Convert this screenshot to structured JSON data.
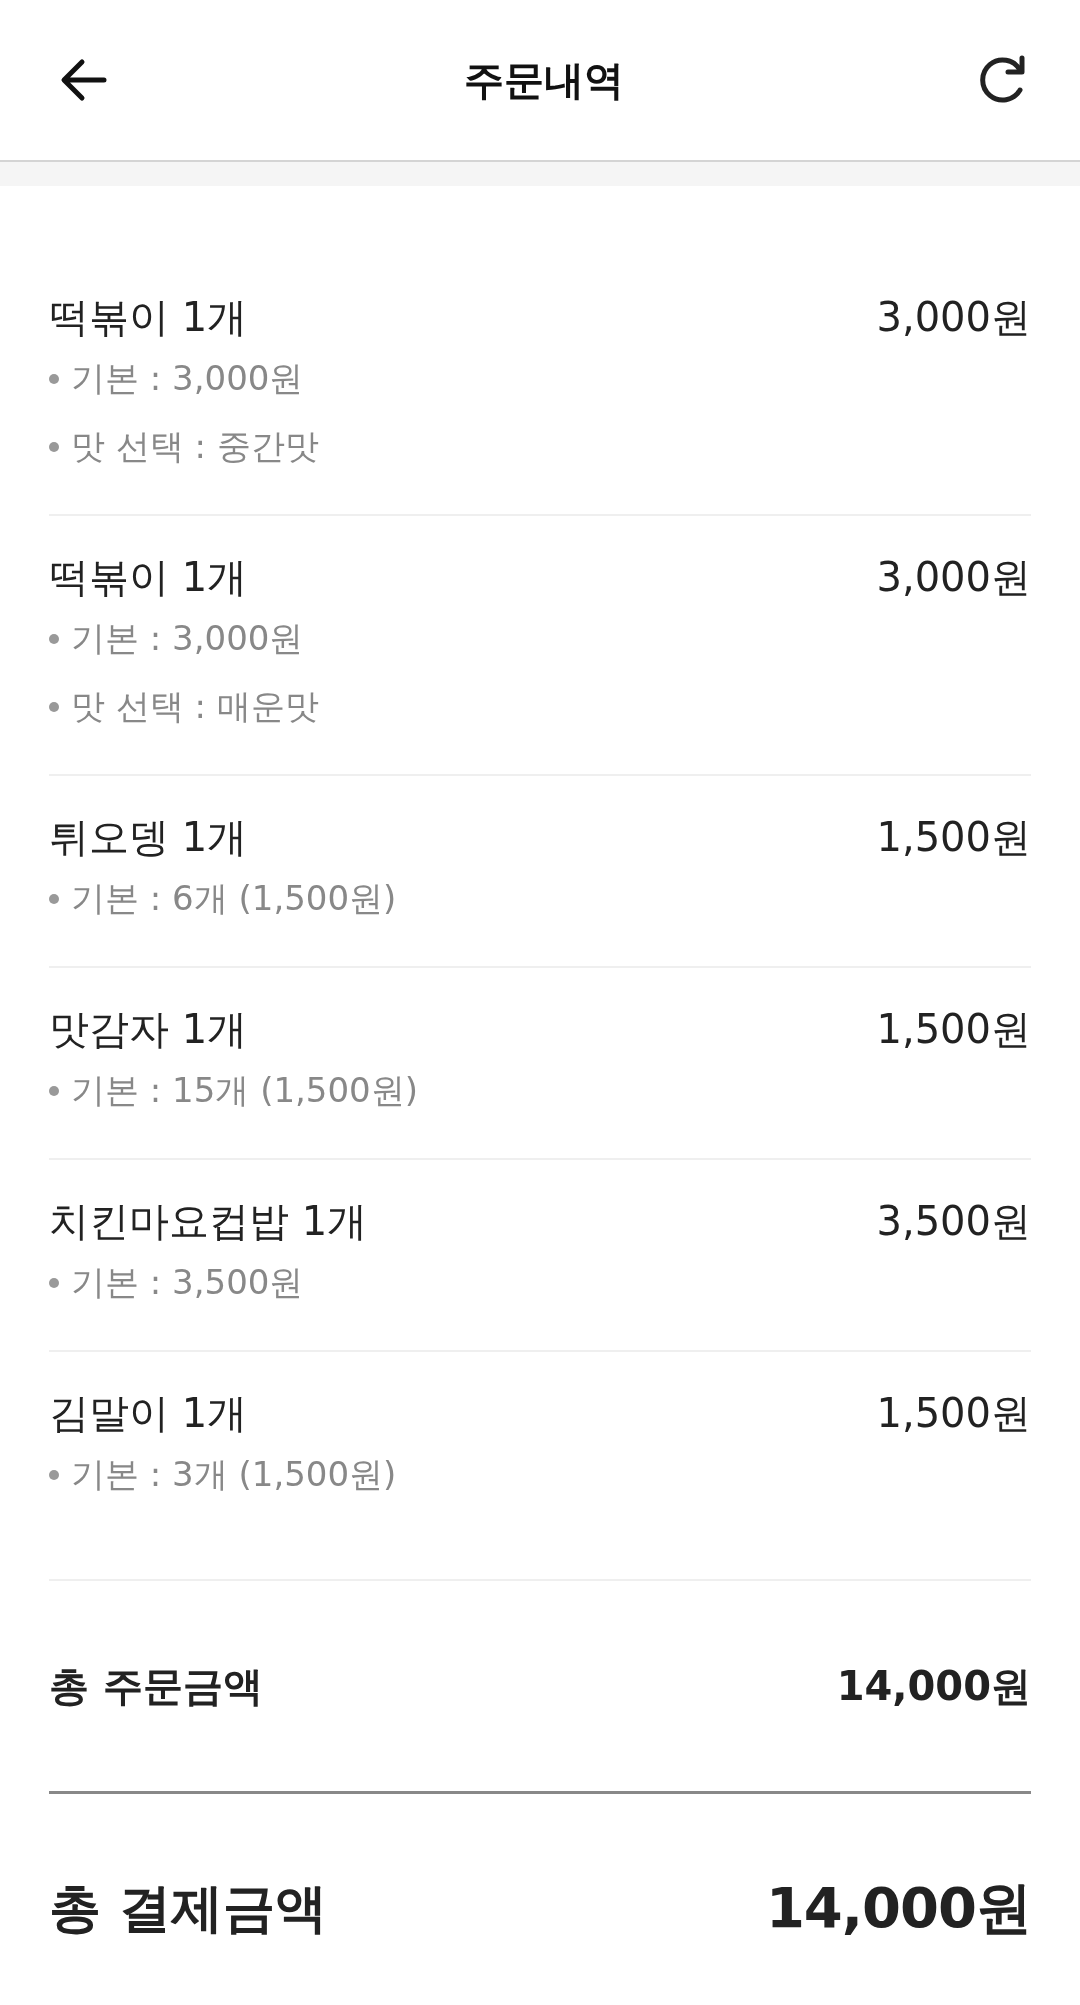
{
  "header": {
    "title": "주문내역"
  },
  "items": [
    {
      "name": "떡볶이 1개",
      "price": "3,000원",
      "options": [
        "기본 : 3,000원",
        "맛 선택 : 중간맛"
      ]
    },
    {
      "name": "떡볶이 1개",
      "price": "3,000원",
      "options": [
        "기본 : 3,000원",
        "맛 선택 : 매운맛"
      ]
    },
    {
      "name": "튀오뎅 1개",
      "price": "1,500원",
      "options": [
        "기본 : 6개 (1,500원)"
      ]
    },
    {
      "name": "맛감자 1개",
      "price": "1,500원",
      "options": [
        "기본 : 15개 (1,500원)"
      ]
    },
    {
      "name": "치킨마요컵밥 1개",
      "price": "3,500원",
      "options": [
        "기본 : 3,500원"
      ]
    },
    {
      "name": "김말이 1개",
      "price": "1,500원",
      "options": [
        "기본 : 3개 (1,500원)"
      ]
    }
  ],
  "order_total": {
    "label": "총 주문금액",
    "value": "14,000원"
  },
  "payment_total": {
    "label": "총 결제금액",
    "value": "14,000원"
  }
}
